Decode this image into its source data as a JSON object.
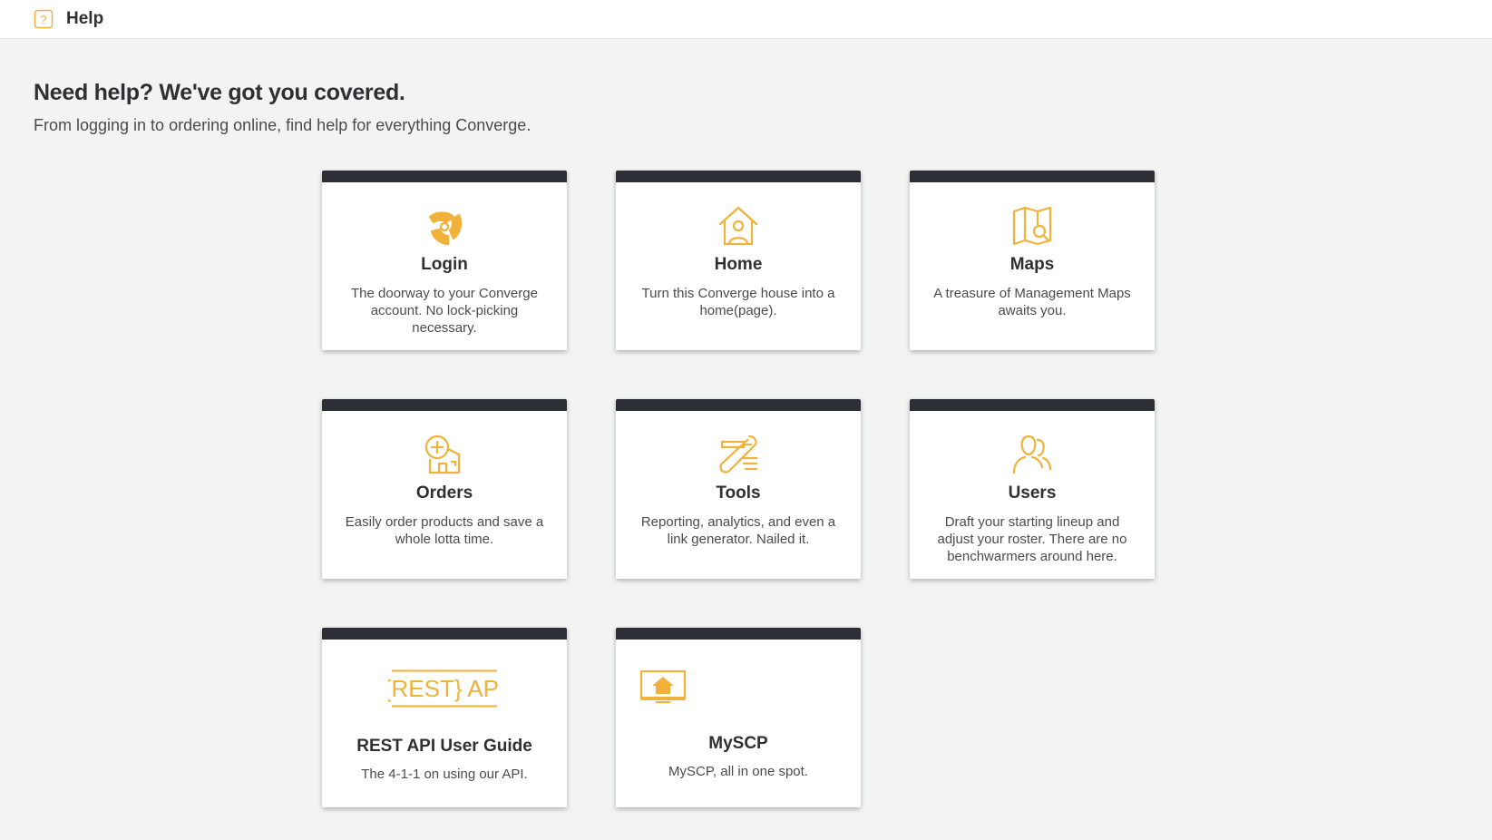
{
  "header": {
    "title": "Help",
    "icon": "help-icon"
  },
  "hero": {
    "headline": "Need help? We've got you covered.",
    "subheadline": "From logging in to ordering online, find help for everything Converge."
  },
  "colors": {
    "accent": "#f0b23a",
    "card_bar": "#2d2f36",
    "background": "#f2f4f3"
  },
  "cards": [
    {
      "title": "Login",
      "description": "The doorway to your Converge account. No lock-picking necessary.",
      "icon": "login-icon"
    },
    {
      "title": "Home",
      "description": "Turn this Converge house into a home(page).",
      "icon": "home-icon"
    },
    {
      "title": "Maps",
      "description": "A treasure of Management Maps awaits you.",
      "icon": "maps-icon"
    },
    {
      "title": "Orders",
      "description": "Easily order products and save a whole lotta time.",
      "icon": "orders-icon"
    },
    {
      "title": "Tools",
      "description": "Reporting, analytics, and even a link generator. Nailed it.",
      "icon": "tools-icon"
    },
    {
      "title": "Users",
      "description": "Draft your starting lineup and adjust your roster. There are no benchwarmers around here.",
      "icon": "users-icon"
    },
    {
      "title": "REST API User Guide",
      "description": "The 4-1-1 on using our API.",
      "icon": "rest-api-icon",
      "icon_text": "{REST} API"
    },
    {
      "title": "MySCP",
      "description": "MySCP, all in one spot.",
      "icon": "myscp-icon"
    }
  ]
}
